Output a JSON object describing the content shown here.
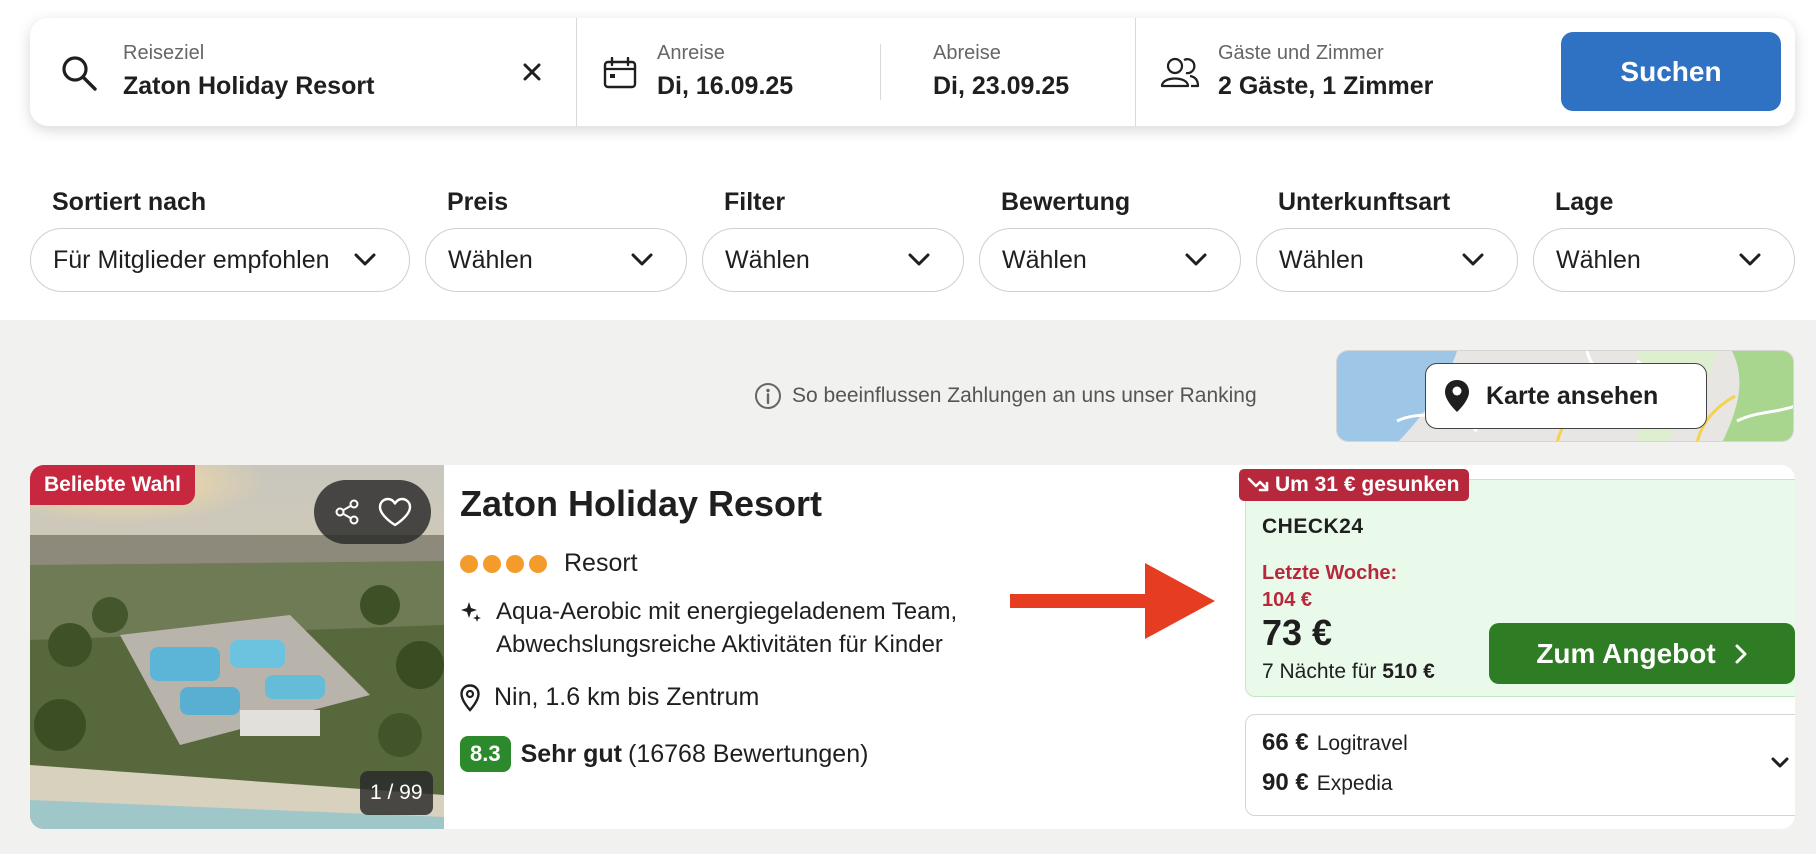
{
  "search": {
    "destination_label": "Reiseziel",
    "destination_value": "Zaton Holiday Resort",
    "checkin_label": "Anreise",
    "checkin_value": "Di, 16.09.25",
    "checkout_label": "Abreise",
    "checkout_value": "Di, 23.09.25",
    "guests_label": "Gäste und Zimmer",
    "guests_value": "2 Gäste, 1 Zimmer",
    "search_button": "Suchen"
  },
  "filters": [
    {
      "label": "Sortiert nach",
      "value": "Für Mitglieder empfohlen"
    },
    {
      "label": "Preis",
      "value": "Wählen"
    },
    {
      "label": "Filter",
      "value": "Wählen"
    },
    {
      "label": "Bewertung",
      "value": "Wählen"
    },
    {
      "label": "Unterkunftsart",
      "value": "Wählen"
    },
    {
      "label": "Lage",
      "value": "Wählen"
    }
  ],
  "ranking_info": "So beeinflussen Zahlungen an uns unser Ranking",
  "map_button": "Karte ansehen",
  "hotel": {
    "badge": "Beliebte Wahl",
    "photo_counter": "1 / 99",
    "name": "Zaton Holiday Resort",
    "star_count": 4,
    "type": "Resort",
    "highlights": "Aqua-Aerobic mit energiegeladenem Team, Abwechslungsreiche Aktivitäten für Kinder",
    "location": "Nin, 1.6 km bis Zentrum",
    "rating_score": "8.3",
    "rating_label": "Sehr gut",
    "rating_count": "(16768 Bewertungen)"
  },
  "offer": {
    "drop_badge": "Um 31 € gesunken",
    "provider": "CHECK24",
    "last_week_label": "Letzte Woche:",
    "last_week_price": "104 €",
    "price": "73 €",
    "nights_text": "7 Nächte für",
    "total": "510 €",
    "cta": "Zum Angebot"
  },
  "other_offers": [
    {
      "price": "66 €",
      "provider": "Logitravel"
    },
    {
      "price": "90 €",
      "provider": "Expedia"
    }
  ],
  "colors": {
    "primary_blue": "#2f72c4",
    "cta_green": "#2e7d24",
    "badge_red": "#c8283f",
    "price_drop_red": "#b8283c",
    "rating_green": "#2c8a2c",
    "annotation_arrow": "#e63d22",
    "star_orange": "#f39c2c"
  }
}
